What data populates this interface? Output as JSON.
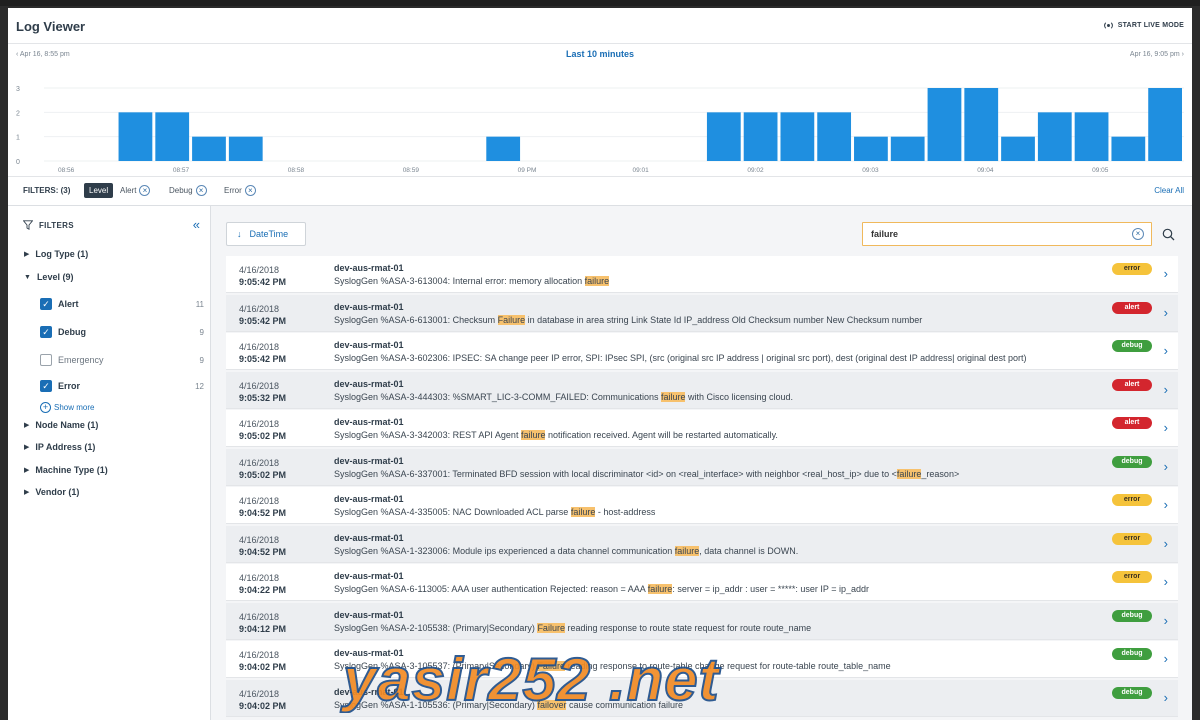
{
  "app": {
    "title": "Log Viewer",
    "live_mode_label": "START LIVE MODE"
  },
  "time_range": {
    "start": "Apr 16, 8:55 pm",
    "label": "Last 10 minutes",
    "end": "Apr 16, 9:05 pm"
  },
  "histogram": {
    "y_ticks": [
      "3",
      "2",
      "1",
      "0"
    ],
    "x_ticks": [
      "08:56",
      "08:57",
      "08:58",
      "08:59",
      "09 PM",
      "09:01",
      "09:02",
      "09:03",
      "09:04",
      "09:05"
    ],
    "bar_values": [
      0,
      0,
      2,
      2,
      1,
      1,
      0,
      0,
      0,
      0,
      0,
      0,
      1,
      0,
      0,
      0,
      0,
      0,
      2,
      2,
      2,
      2,
      1,
      1,
      3,
      3,
      1,
      2,
      2,
      1,
      3
    ],
    "y_max": 3,
    "bar_color": "#1f8fe0"
  },
  "filters": {
    "label": "FILTERS: (3)",
    "group_chip": "Level",
    "chips": [
      "Alert",
      "Debug",
      "Error"
    ],
    "clear_all": "Clear All"
  },
  "sidebar": {
    "title": "FILTERS",
    "collapse_icon": "«",
    "groups_top": [
      {
        "label": "Log Type (1)",
        "expanded": false
      },
      {
        "label": "Level (9)",
        "expanded": true
      }
    ],
    "level_options": [
      {
        "label": "Alert",
        "count": "11",
        "checked": true
      },
      {
        "label": "Debug",
        "count": "9",
        "checked": true
      },
      {
        "label": "Emergency",
        "count": "9",
        "checked": false
      },
      {
        "label": "Error",
        "count": "12",
        "checked": true
      }
    ],
    "show_more": "Show more",
    "groups_bottom": [
      {
        "label": "Node Name (1)"
      },
      {
        "label": "IP Address (1)"
      },
      {
        "label": "Machine Type (1)"
      },
      {
        "label": "Vendor (1)"
      }
    ]
  },
  "toolbar": {
    "sort_label": "DateTime",
    "sort_icon": "↓",
    "search_value": "failure",
    "clear_icon": "⊗"
  },
  "logs": [
    {
      "date": "4/16/2018",
      "time": "9:05:42 PM",
      "host": "dev-aus-rmat-01",
      "pre": "SyslogGen %ASA-3-613004: Internal error: memory allocation ",
      "match": "failure",
      "post": "",
      "level": "error"
    },
    {
      "date": "4/16/2018",
      "time": "9:05:42 PM",
      "host": "dev-aus-rmat-01",
      "pre": "SyslogGen %ASA-6-613001: Checksum ",
      "match": "Failure",
      "post": " in database in area string Link State Id IP_address Old Checksum number New Checksum number",
      "level": "alert"
    },
    {
      "date": "4/16/2018",
      "time": "9:05:42 PM",
      "host": "dev-aus-rmat-01",
      "pre": "SyslogGen %ASA-3-602306: IPSEC: SA change peer IP error, SPI: IPsec SPI, (src (original src IP address | original src port), dest (original dest IP address| original dest port)",
      "match": "",
      "post": "",
      "level": "debug"
    },
    {
      "date": "4/16/2018",
      "time": "9:05:32 PM",
      "host": "dev-aus-rmat-01",
      "pre": "SyslogGen %ASA-3-444303: %SMART_LIC-3-COMM_FAILED: Communications ",
      "match": "failure",
      "post": " with Cisco licensing cloud.",
      "level": "alert"
    },
    {
      "date": "4/16/2018",
      "time": "9:05:02 PM",
      "host": "dev-aus-rmat-01",
      "pre": "SyslogGen %ASA-3-342003: REST API Agent ",
      "match": "failure",
      "post": " notification received. Agent will be restarted automatically.",
      "level": "alert"
    },
    {
      "date": "4/16/2018",
      "time": "9:05:02 PM",
      "host": "dev-aus-rmat-01",
      "pre": "SyslogGen %ASA-6-337001: Terminated BFD session with local discriminator <id> on <real_interface> with neighbor <real_host_ip> due to <",
      "match": "failure",
      "post": "_reason>",
      "level": "debug"
    },
    {
      "date": "4/16/2018",
      "time": "9:04:52 PM",
      "host": "dev-aus-rmat-01",
      "pre": "SyslogGen %ASA-4-335005: NAC Downloaded ACL parse ",
      "match": "failure",
      "post": " - host-address",
      "level": "error"
    },
    {
      "date": "4/16/2018",
      "time": "9:04:52 PM",
      "host": "dev-aus-rmat-01",
      "pre": "SyslogGen %ASA-1-323006: Module ips experienced a data channel communication ",
      "match": "failure",
      "post": ", data channel is DOWN.",
      "level": "error"
    },
    {
      "date": "4/16/2018",
      "time": "9:04:22 PM",
      "host": "dev-aus-rmat-01",
      "pre": "SyslogGen %ASA-6-113005: AAA user authentication Rejected: reason = AAA ",
      "match": "failure",
      "post": ": server = ip_addr : user = *****: user IP = ip_addr",
      "level": "error"
    },
    {
      "date": "4/16/2018",
      "time": "9:04:12 PM",
      "host": "dev-aus-rmat-01",
      "pre": "SyslogGen %ASA-2-105538: (Primary|Secondary) ",
      "match": "Failure",
      "post": " reading response to route state request for route route_name",
      "level": "debug"
    },
    {
      "date": "4/16/2018",
      "time": "9:04:02 PM",
      "host": "dev-aus-rmat-01",
      "pre": "SyslogGen %ASA-3-105537: (Primary|Secondary) ",
      "match": "Failure",
      "post": " reading response to route-table change request for route-table route_table_name",
      "level": "debug"
    },
    {
      "date": "4/16/2018",
      "time": "9:04:02 PM",
      "host": "dev-aus-rmat-01",
      "pre": "SyslogGen %ASA-1-105536: (Primary|Secondary) ",
      "match": "failover",
      "post": " cause communication failure",
      "level": "debug"
    }
  ],
  "watermark": "yasir252 .net"
}
